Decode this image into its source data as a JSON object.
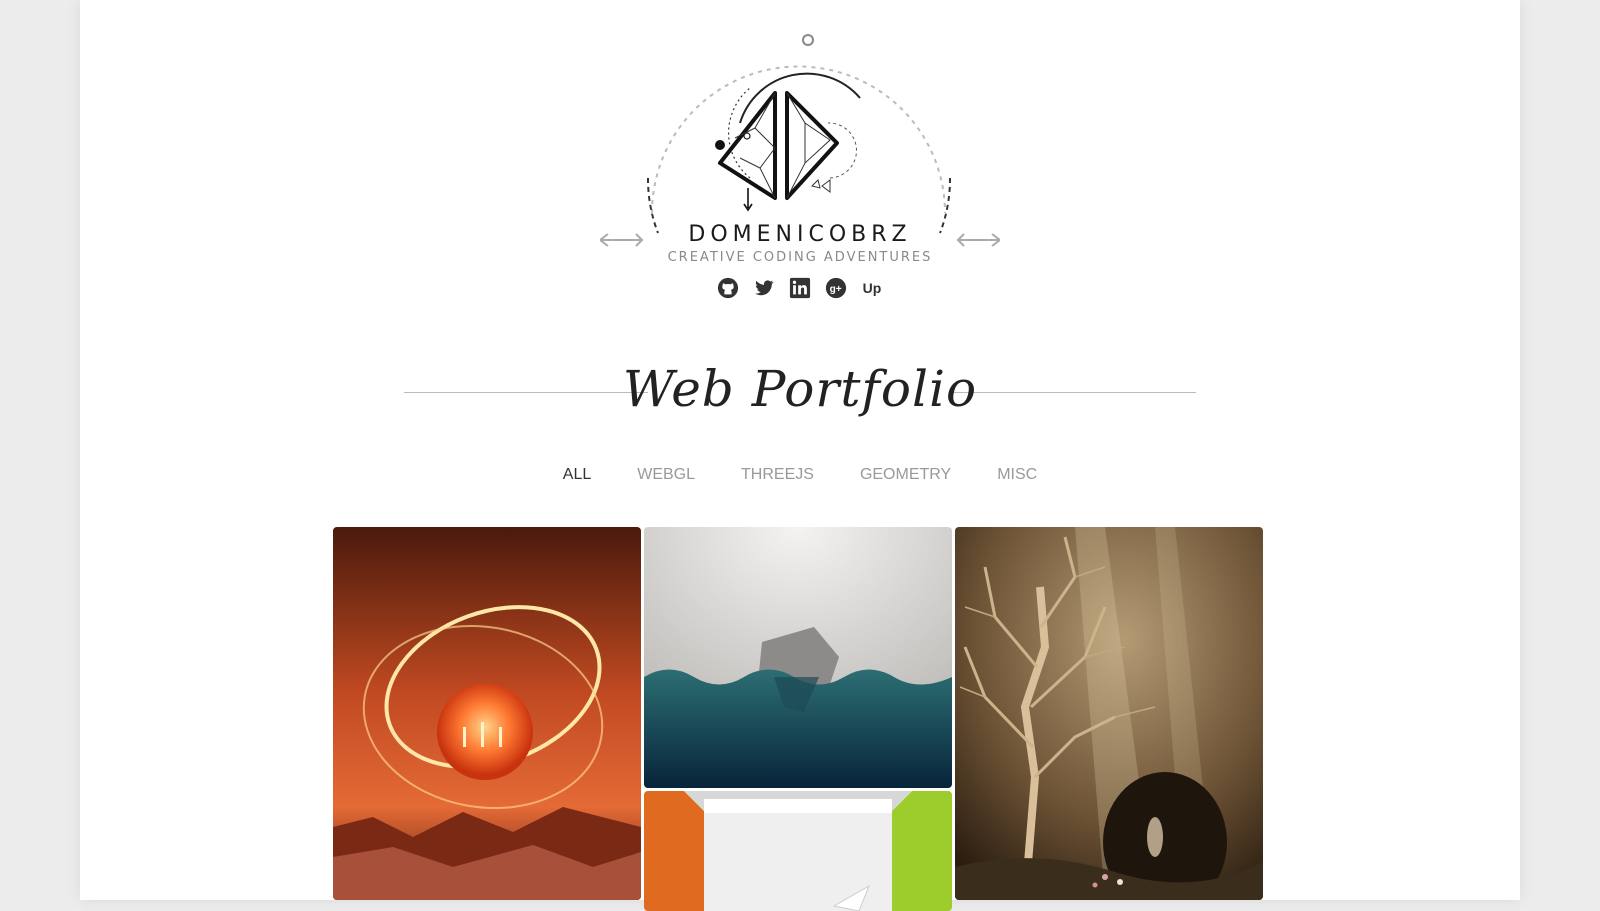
{
  "brand": {
    "name": "DOMENICOBRZ",
    "tagline": "CREATIVE CODING ADVENTURES"
  },
  "social": [
    {
      "name": "github",
      "icon": "github-icon"
    },
    {
      "name": "twitter",
      "icon": "twitter-icon"
    },
    {
      "name": "linkedin",
      "icon": "linkedin-icon"
    },
    {
      "name": "google-plus",
      "icon": "google-plus-icon"
    },
    {
      "name": "upwork",
      "icon": "upwork-icon",
      "label": "Up"
    }
  ],
  "section": {
    "title": "Web Portfolio"
  },
  "filters": [
    {
      "label": "ALL",
      "active": true
    },
    {
      "label": "WEBGL",
      "active": false
    },
    {
      "label": "THREEJS",
      "active": false
    },
    {
      "label": "GEOMETRY",
      "active": false
    },
    {
      "label": "MISC",
      "active": false
    }
  ],
  "portfolio_items": [
    {
      "name": "orange-orb-scene",
      "palette": [
        "#6b1f0c",
        "#e2552a",
        "#ffd17a"
      ]
    },
    {
      "name": "ocean-waves-scene",
      "palette": [
        "#d9d6d3",
        "#1c4c56",
        "#0c2333"
      ]
    },
    {
      "name": "tree-light-scene",
      "palette": [
        "#2f2112",
        "#8c6d48",
        "#e6cfa7"
      ]
    },
    {
      "name": "room-light-scene",
      "palette": [
        "#e26a1c",
        "#f2f2f2",
        "#9ccb2d"
      ]
    }
  ],
  "colors": {
    "page_bg": "#ffffff",
    "outer_bg": "#ececec",
    "text_dark": "#1a1a1a",
    "text_muted": "#8a8a8a"
  }
}
